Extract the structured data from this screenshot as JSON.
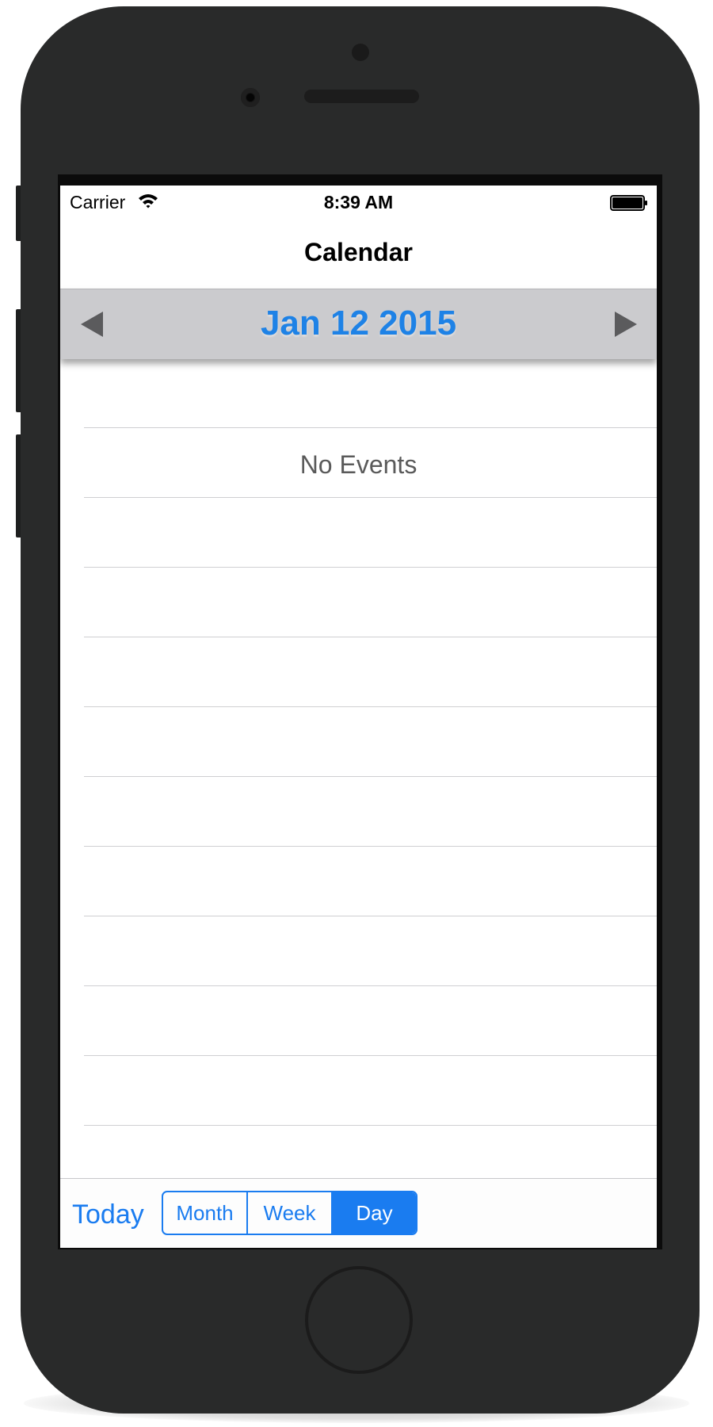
{
  "status_bar": {
    "carrier": "Carrier",
    "time": "8:39 AM",
    "wifi_icon": "wifi-icon",
    "battery_icon": "battery-full-icon"
  },
  "nav": {
    "title": "Calendar"
  },
  "date_bar": {
    "date": "Jan 12 2015",
    "prev_icon": "triangle-left-icon",
    "next_icon": "triangle-right-icon"
  },
  "events": {
    "empty_message": "No Events",
    "row_count": 11
  },
  "toolbar": {
    "today_label": "Today",
    "segments": [
      {
        "label": "Month",
        "selected": false
      },
      {
        "label": "Week",
        "selected": false
      },
      {
        "label": "Day",
        "selected": true
      }
    ]
  },
  "colors": {
    "accent": "#1a7cf0",
    "date_text": "#1e82e6",
    "date_bar_bg": "#cbcbce",
    "phone_body": "#292a2a"
  }
}
